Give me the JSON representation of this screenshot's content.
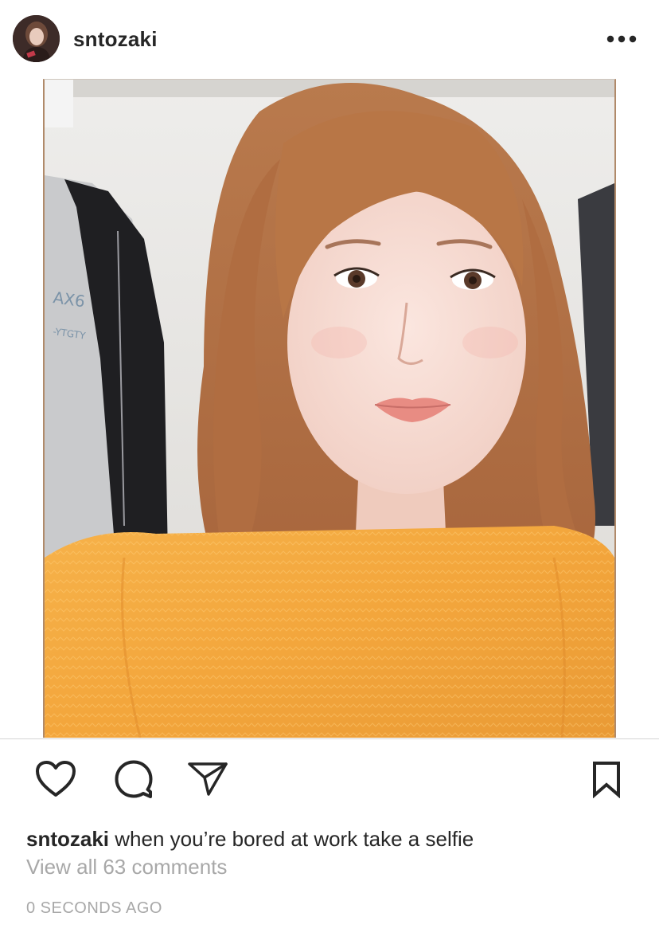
{
  "post": {
    "username": "sntozaki",
    "caption_text": "when you’re bored at work take a selfie",
    "view_comments": "View all 63 comments",
    "timestamp": "0 SECONDS AGO"
  },
  "icons": {
    "more": "more-horizontal-icon",
    "like": "heart-icon",
    "comment": "comment-bubble-icon",
    "share": "paper-plane-icon",
    "save": "bookmark-icon"
  },
  "colors": {
    "text": "#262626",
    "muted": "#a8a8a8",
    "divider": "#d5d5d5"
  }
}
